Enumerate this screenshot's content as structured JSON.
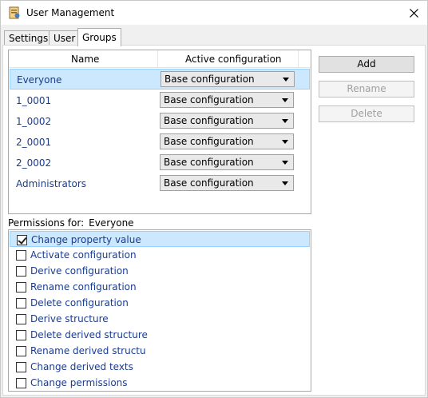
{
  "window": {
    "title": "User Management",
    "close_symbol": "✕"
  },
  "tabs": [
    {
      "label": "Settings",
      "active": false
    },
    {
      "label": "User",
      "active": false
    },
    {
      "label": "Groups",
      "active": true
    }
  ],
  "groups_table": {
    "columns": [
      "Name",
      "Active configuration"
    ],
    "rows": [
      {
        "name": "Everyone",
        "configuration": "Base configuration",
        "selected": true
      },
      {
        "name": "1_0001",
        "configuration": "Base configuration",
        "selected": false
      },
      {
        "name": "1_0002",
        "configuration": "Base configuration",
        "selected": false
      },
      {
        "name": "2_0001",
        "configuration": "Base configuration",
        "selected": false
      },
      {
        "name": "2_0002",
        "configuration": "Base configuration",
        "selected": false
      },
      {
        "name": "Administrators",
        "configuration": "Base configuration",
        "selected": false
      }
    ]
  },
  "buttons": {
    "add": {
      "label": "Add",
      "enabled": true
    },
    "rename": {
      "label": "Rename",
      "enabled": false
    },
    "delete": {
      "label": "Delete",
      "enabled": false
    }
  },
  "permissions": {
    "label": "Permissions for:",
    "group": "Everyone",
    "items": [
      {
        "label": "Change property value",
        "checked": true,
        "selected": true
      },
      {
        "label": "Activate configuration",
        "checked": false,
        "selected": false
      },
      {
        "label": "Derive configuration",
        "checked": false,
        "selected": false
      },
      {
        "label": "Rename configuration",
        "checked": false,
        "selected": false
      },
      {
        "label": "Delete configuration",
        "checked": false,
        "selected": false
      },
      {
        "label": "Derive structure",
        "checked": false,
        "selected": false
      },
      {
        "label": "Delete derived structure",
        "checked": false,
        "selected": false
      },
      {
        "label": "Rename derived structu",
        "checked": false,
        "selected": false
      },
      {
        "label": "Change derived texts",
        "checked": false,
        "selected": false
      },
      {
        "label": "Change permissions",
        "checked": false,
        "selected": false
      }
    ]
  },
  "icons": {
    "app": "user-management-app-icon",
    "close": "close-icon",
    "dropdown": "chevron-down-icon",
    "checkbox": "checkbox-icon"
  },
  "colors": {
    "selection_bg": "#cce8ff",
    "selection_border": "#99d1ff",
    "item_text": "#1a3c8f",
    "dialog_bg": "#f0f0f0"
  }
}
